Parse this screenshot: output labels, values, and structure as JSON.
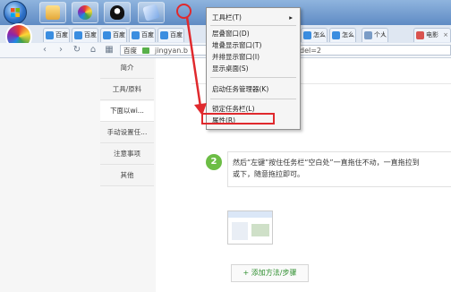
{
  "browser": {
    "tabs": [
      {
        "label": "百度"
      },
      {
        "label": "百度"
      },
      {
        "label": "百度"
      },
      {
        "label": "百度"
      },
      {
        "label": "百度"
      },
      {
        "label": "怎么"
      },
      {
        "label": "怎么"
      },
      {
        "label": "个人"
      },
      {
        "label": "电影"
      }
    ],
    "bookmark": "百度",
    "address_start": "jingyan.b",
    "address_end": "del=2"
  },
  "sidebar": {
    "items": [
      {
        "label": "简介"
      },
      {
        "label": "工具/原料"
      },
      {
        "label": "下面以wi..."
      },
      {
        "label": "手动设置任..."
      },
      {
        "label": "注意事项"
      },
      {
        "label": "其他"
      }
    ]
  },
  "context_menu": {
    "items": [
      {
        "label": "工具栏(T)",
        "arrow": "▸"
      },
      {
        "label": "层叠窗口(D)"
      },
      {
        "label": "堆叠显示窗口(T)"
      },
      {
        "label": "并排显示窗口(I)"
      },
      {
        "label": "显示桌面(S)"
      },
      {
        "label": "启动任务管理器(K)"
      },
      {
        "label": "锁定任务栏(L)"
      },
      {
        "label": "属性(R)"
      }
    ]
  },
  "step": {
    "number": "2",
    "text_line1": "然后“左键”按住任务栏“空白处”一直拖住不动，一直拖拉到",
    "text_line2": "或下，随意拖拉即可。"
  },
  "add_method_button": "+ 添加方法/步骤",
  "colors": {
    "highlight_red": "#e0292d",
    "step_green": "#6cbd45",
    "add_green": "#2f8f2f"
  }
}
